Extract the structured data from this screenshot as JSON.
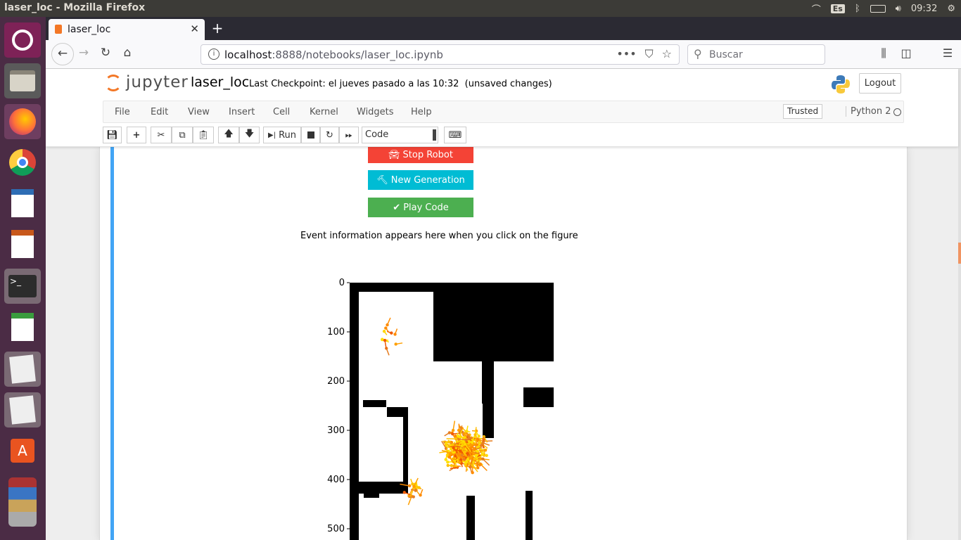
{
  "os": {
    "window_title": "laser_loc - Mozilla Firefox",
    "keyboard_layout": "Es",
    "clock": "09:32",
    "launcher_icons": [
      "ubuntu-dash-icon",
      "files-icon",
      "firefox-icon",
      "chrome-icon",
      "writer-icon",
      "impress-icon",
      "terminal-icon",
      "calc-icon",
      "text-editor-icon",
      "text-editor-icon",
      "software-center-icon",
      "stacked-apps-icon"
    ]
  },
  "browser": {
    "tab_title": "laser_loc",
    "url_host": "localhost",
    "url_rest": ":8888/notebooks/laser_loc.ipynb",
    "search_placeholder": "Buscar",
    "more_label": "•••"
  },
  "jupyter": {
    "logo_text": "jupyter",
    "notebook_name": "laser_loc",
    "checkpoint": "Last Checkpoint: el jueves pasado a las 10:32",
    "unsaved": "(unsaved changes)",
    "logout": "Logout",
    "menu": [
      "File",
      "Edit",
      "View",
      "Insert",
      "Cell",
      "Kernel",
      "Widgets",
      "Help"
    ],
    "trusted": "Trusted",
    "kernel": "Python 2",
    "toolbar": {
      "run_label": "Run",
      "cell_type": "Code"
    }
  },
  "output": {
    "buttons": [
      {
        "label": "Stop Robot",
        "icon": "car-icon",
        "color": "#f44336"
      },
      {
        "label": "New Generation",
        "icon": "gavel-icon",
        "color": "#00bcd4"
      },
      {
        "label": "Play Code",
        "icon": "check-icon",
        "color": "#4caf50"
      }
    ],
    "event_info": "Event information appears here when you click on the figure"
  },
  "chart_data": {
    "type": "heatmap",
    "title": "",
    "xlabel": "",
    "ylabel": "",
    "y_ticks": [
      0,
      100,
      200,
      300,
      400,
      500
    ],
    "ylim": [
      500,
      0
    ],
    "description_colors": {
      "wall": "#000000",
      "free": "#ffffff",
      "particle_dense": "#ff8c00",
      "particle_sparse": "#ffd700"
    },
    "particle_clusters": [
      {
        "x": 235,
        "y": 340,
        "spread": 55,
        "count": 260
      },
      {
        "x": 80,
        "y": 110,
        "spread": 35,
        "count": 10
      },
      {
        "x": 130,
        "y": 420,
        "spread": 25,
        "count": 15
      }
    ]
  }
}
